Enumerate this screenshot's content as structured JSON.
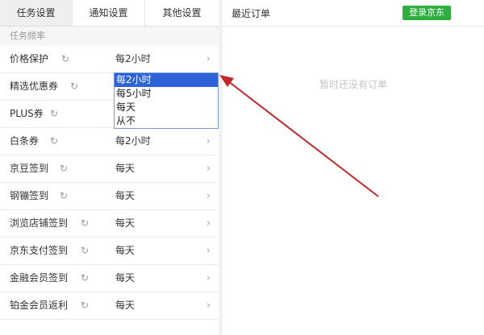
{
  "tabs": [
    "任务设置",
    "通知设置",
    "其他设置"
  ],
  "section_title": "任务频率",
  "rows": [
    {
      "name": "价格保护",
      "value": "每2小时"
    },
    {
      "name": "精选优惠券",
      "value": ""
    },
    {
      "name": "PLUS券",
      "value": ""
    },
    {
      "name": "白条券",
      "value": "每2小时"
    },
    {
      "name": "京豆签到",
      "value": "每天"
    },
    {
      "name": "钢镚签到",
      "value": "每天"
    },
    {
      "name": "浏览店铺签到",
      "value": "每天"
    },
    {
      "name": "京东支付签到",
      "value": "每天"
    },
    {
      "name": "金融会员签到",
      "value": "每天"
    },
    {
      "name": "铂金会员返利",
      "value": "每天"
    }
  ],
  "dropdown": {
    "options": [
      "每2小时",
      "每5小时",
      "每天",
      "从不"
    ],
    "selected": "每2小时"
  },
  "right_panel": {
    "title": "最近订单",
    "login_button": "登录京东",
    "empty_text": "暂时还没有订单"
  },
  "icons": {
    "refresh": "refresh-icon",
    "chevron": "chevron-right-icon"
  },
  "colors": {
    "accent_green": "#2dae3e",
    "selection_blue": "#2f62d8",
    "annotation_red": "#c0262b"
  }
}
